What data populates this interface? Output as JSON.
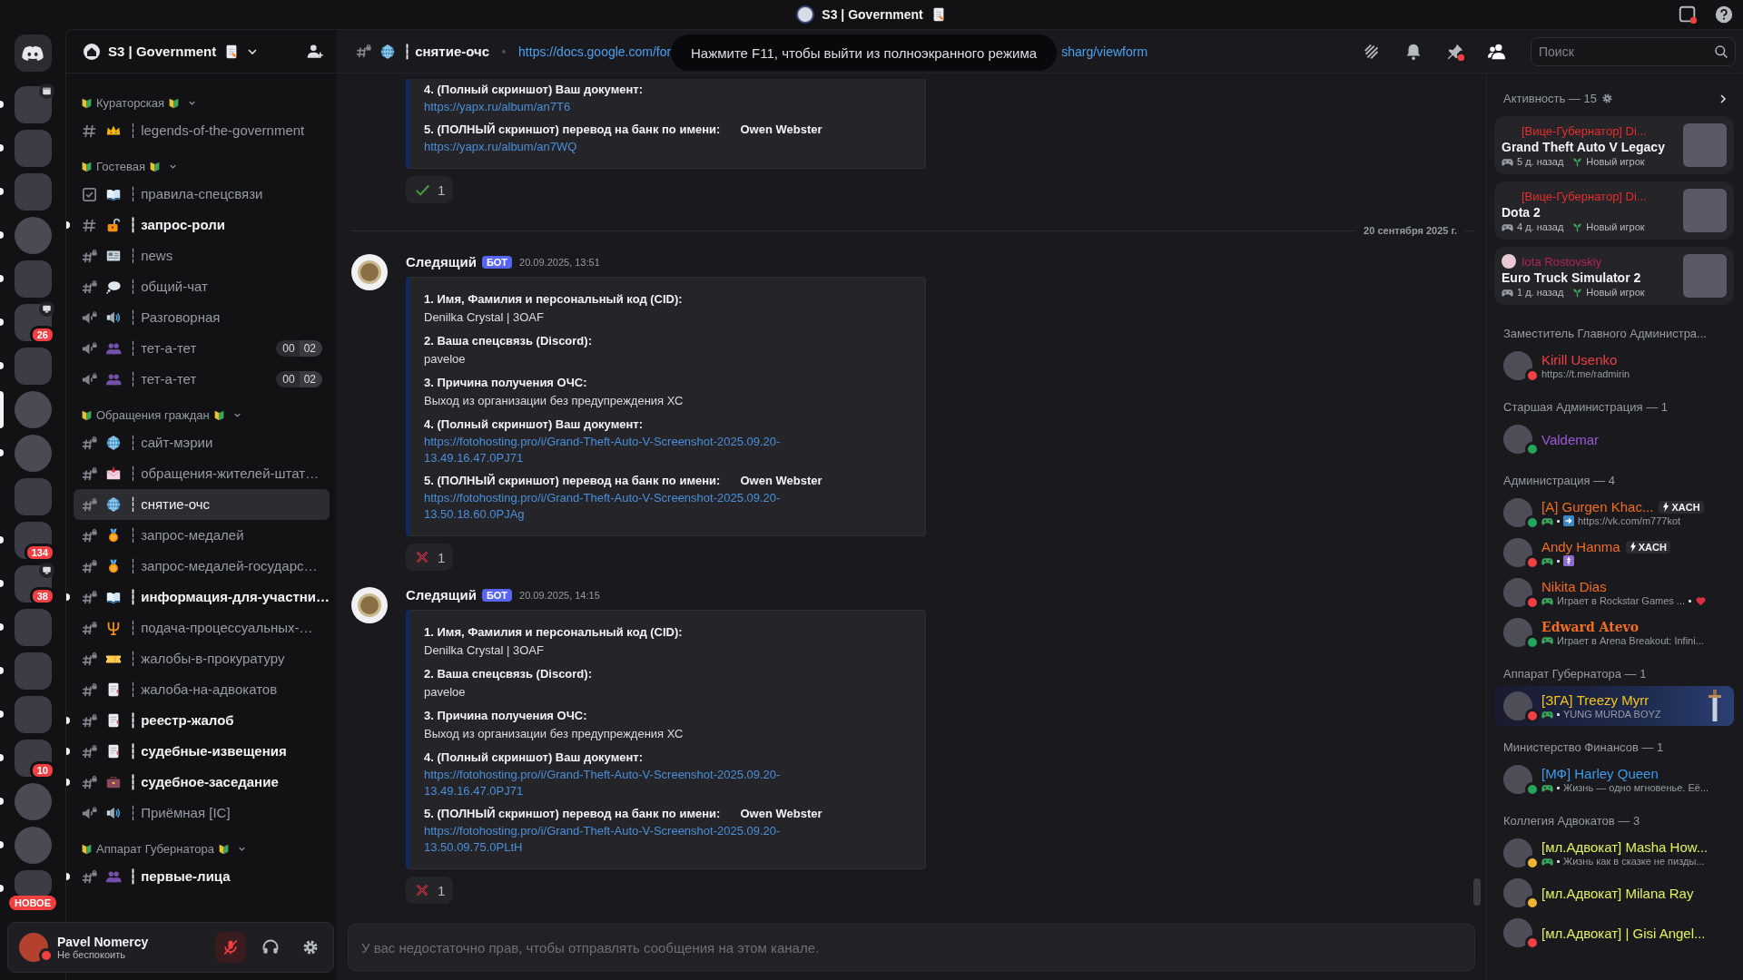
{
  "title_bar": {
    "server_name": "S3 | Government",
    "inbox_alert": true
  },
  "servers": [
    {
      "kind": "home",
      "unread": false,
      "selected": false
    },
    {
      "kind": "square",
      "event": true,
      "unread": true,
      "selected": false
    },
    {
      "kind": "square",
      "unread": true,
      "selected": false
    },
    {
      "kind": "square",
      "unread": true,
      "selected": false
    },
    {
      "kind": "round",
      "unread": true,
      "selected": false
    },
    {
      "kind": "square",
      "unread": true,
      "selected": false
    },
    {
      "kind": "square",
      "screen_share": true,
      "badge": "26",
      "unread": true,
      "selected": false
    },
    {
      "kind": "square",
      "unread": true,
      "selected": false
    },
    {
      "kind": "round",
      "unread": false,
      "selected": true
    },
    {
      "kind": "round",
      "unread": true,
      "selected": false
    },
    {
      "kind": "square",
      "unread": false,
      "selected": false
    },
    {
      "kind": "square",
      "badge": "134",
      "unread": true,
      "selected": false
    },
    {
      "kind": "square",
      "screen_share": true,
      "badge": "38",
      "unread": true,
      "selected": false
    },
    {
      "kind": "square",
      "unread": true,
      "selected": false
    },
    {
      "kind": "square",
      "unread": true,
      "selected": false
    },
    {
      "kind": "square",
      "unread": true,
      "selected": false
    },
    {
      "kind": "square",
      "badge": "10",
      "unread": true,
      "selected": false
    },
    {
      "kind": "round",
      "unread": true,
      "selected": false
    },
    {
      "kind": "round",
      "unread": true,
      "selected": false
    },
    {
      "kind": "square",
      "badge": "НОВОЕ",
      "unread": true,
      "selected": false
    }
  ],
  "sidebar": {
    "server_name": "S3 | Government",
    "categories": [
      {
        "name": "Кураторская",
        "channels": [
          {
            "kind": "text",
            "name": "┆ legends-of-the-government",
            "unread": false,
            "selected": false
          }
        ]
      },
      {
        "name": "Гостевая",
        "channels": [
          {
            "kind": "rules",
            "name": "┆ правила-спецсвязи",
            "unread": false,
            "selected": false
          },
          {
            "kind": "text",
            "name": "┆ запрос-роли",
            "unread": true,
            "selected": false
          },
          {
            "kind": "text_locked",
            "name": "┆ news",
            "unread": false,
            "selected": false
          },
          {
            "kind": "text_locked",
            "name": "┆ общий-чат",
            "unread": false,
            "selected": false
          },
          {
            "kind": "voice_locked",
            "name": "┆ Разговорная",
            "unread": false,
            "selected": false
          },
          {
            "kind": "voice_locked",
            "name": "┆ тет-а-тет",
            "unread": false,
            "selected": false,
            "counters": [
              "00",
              "02"
            ]
          },
          {
            "kind": "voice_locked",
            "name": "┆ тет-а-тет",
            "unread": false,
            "selected": false,
            "counters": [
              "00",
              "02"
            ]
          }
        ]
      },
      {
        "name": "Обращения граждан",
        "channels": [
          {
            "kind": "text_locked",
            "name": "┆ сайт-мэрии",
            "unread": false,
            "selected": false
          },
          {
            "kind": "text_locked",
            "name": "┆ обращения-жителей-штат…",
            "unread": false,
            "selected": false
          },
          {
            "kind": "text_locked",
            "name": "┆ снятие-очс",
            "unread": false,
            "selected": true
          },
          {
            "kind": "text_locked",
            "name": "┆ запрос-медалей",
            "unread": false,
            "selected": false
          },
          {
            "kind": "text_locked",
            "name": "┆ запрос-медалей-государс…",
            "unread": false,
            "selected": false
          },
          {
            "kind": "text_locked",
            "name": "┆ информация-для-участни…",
            "unread": true,
            "selected": false
          },
          {
            "kind": "text_locked",
            "name": "┆ подача-процессуальных-…",
            "unread": false,
            "selected": false
          },
          {
            "kind": "text_locked",
            "name": "┆ жалобы-в-прокуратуру",
            "unread": false,
            "selected": false
          },
          {
            "kind": "text_locked",
            "name": "┆ жалоба-на-адвокатов",
            "unread": false,
            "selected": false
          },
          {
            "kind": "text_locked",
            "name": "┆ реестр-жалоб",
            "unread": true,
            "selected": false
          },
          {
            "kind": "text_locked",
            "name": "┆ судебные-извещения",
            "unread": true,
            "selected": false
          },
          {
            "kind": "text_locked",
            "name": "┆ судебное-заседание",
            "unread": true,
            "selected": false
          },
          {
            "kind": "voice_locked",
            "name": "┆ Приёмная [IC]",
            "unread": false,
            "selected": false
          }
        ]
      },
      {
        "name": "Аппарат Губернатора",
        "channels": [
          {
            "kind": "text_locked",
            "name": "┆ первые-лица",
            "unread": true,
            "selected": false
          }
        ]
      }
    ]
  },
  "user_panel": {
    "name": "Pavel Nomercy",
    "status_text": "Не беспокоить",
    "status": {
      "color": "#f23f42"
    },
    "muted": true
  },
  "channel_header": {
    "kind": "text_locked",
    "name": "┆ снятие-очс",
    "topic_start": "https://docs.google.com/for",
    "topic_end": "sharg/viewform",
    "pins_alert": true,
    "members_shown": true,
    "search_placeholder": "Поиск"
  },
  "fullscreen_notice": "Нажмите F11, чтобы выйти из полноэкранного режима",
  "messages": [
    {
      "kind": "continuation",
      "fields": [
        {
          "label": "4. (Полный скриншот) Ваш документ:",
          "value": "https://yapx.ru/album/an7T6",
          "link": true
        },
        {
          "label": "5. (ПОЛНЫЙ скриншот) перевод на банк  по имени:",
          "extra": "Owen Webster",
          "value": "https://yapx.ru/album/an7WQ",
          "link": true
        }
      ],
      "reaction": {
        "kind": "check",
        "count": "1"
      }
    },
    {
      "kind": "divider",
      "text": "20 сентября 2025 г."
    },
    {
      "kind": "message",
      "author": "Следящий",
      "tag": "БОТ",
      "time": "20.09.2025, 13:51",
      "fields": [
        {
          "label": "1. Имя, Фамилия и персональный код (CID):",
          "value": "Denilka Crystal | 3OAF",
          "link": false
        },
        {
          "label": "2. Ваша спецсвязь (Discord):",
          "value": "paveloe",
          "link": false
        },
        {
          "label": "3. Причина получения ОЧС:",
          "value": "Выход из организации без предупреждения ХС",
          "link": false
        },
        {
          "label": "4. (Полный скриншот) Ваш документ:",
          "value": "https://fotohosting.pro/i/Grand-Theft-Auto-V-Screenshot-2025.09.20-13.49.16.47.0PJ71",
          "link": true
        },
        {
          "label": "5. (ПОЛНЫЙ скриншот) перевод на банк  по имени:",
          "extra": "Owen Webster",
          "value": "https://fotohosting.pro/i/Grand-Theft-Auto-V-Screenshot-2025.09.20-13.50.18.60.0PJAg",
          "link": true
        }
      ],
      "reaction": {
        "kind": "cross",
        "count": "1"
      }
    },
    {
      "kind": "message",
      "author": "Следящий",
      "tag": "БОТ",
      "time": "20.09.2025, 14:15",
      "fields": [
        {
          "label": "1. Имя, Фамилия и персональный код (CID):",
          "value": "Denilka Crystal | 3OAF",
          "link": false
        },
        {
          "label": "2. Ваша спецсвязь (Discord):",
          "value": "paveloe",
          "link": false
        },
        {
          "label": "3. Причина получения ОЧС:",
          "value": "Выход из организации без предупреждения ХС",
          "link": false
        },
        {
          "label": "4. (Полный скриншот) Ваш документ:",
          "value": "https://fotohosting.pro/i/Grand-Theft-Auto-V-Screenshot-2025.09.20-13.49.16.47.0PJ71",
          "link": true
        },
        {
          "label": "5. (ПОЛНЫЙ скриншот) перевод на банк  по имени:",
          "extra": "Owen Webster",
          "value": "https://fotohosting.pro/i/Grand-Theft-Auto-V-Screenshot-2025.09.20-13.50.09.75.0PLtH",
          "link": true
        }
      ],
      "reaction": {
        "kind": "cross",
        "count": "1"
      }
    }
  ],
  "composer": {
    "placeholder": "У вас недостаточно прав, чтобы отправлять сообщения на этом канале."
  },
  "activity": {
    "title": "Активность — 15",
    "cards": [
      {
        "user": "[Вице-Губернатор] Di...",
        "color": "#e5302b",
        "user_avatar": false,
        "game": "Grand Theft Auto V Legacy",
        "time": "5 д. назад",
        "note": "Новый игрок"
      },
      {
        "user": "[Вице-Губернатор] Di...",
        "color": "#e5302b",
        "user_avatar": false,
        "game": "Dota 2",
        "time": "4 д. назад",
        "note": "Новый игрок"
      },
      {
        "user": "Iota Rostovskiy",
        "color": "#b3245a",
        "user_avatar": true,
        "game": "Euro Truck Simulator 2",
        "time": "1 д. назад",
        "note": "Новый игрок"
      }
    ]
  },
  "member_groups": [
    {
      "title": "Заместитель Главного Администра...",
      "members": [
        {
          "name": "Kirill Usenko",
          "color": "#f23f42",
          "status": {
            "color": "#f23f42"
          },
          "activity": "https://t.me/radmirin",
          "kind": "text"
        }
      ]
    },
    {
      "title": "Старшая Администрация — 1",
      "members": [
        {
          "name": "Valdemar",
          "color": "#9b59d6",
          "status": {
            "color": "#23a55a"
          }
        }
      ]
    },
    {
      "title": "Администрация — 4",
      "members": [
        {
          "name": "[A] Gurgen Khac...",
          "color": "#f26c21",
          "status": {
            "color": "#23a55a"
          },
          "tag": "XACH",
          "activity": "https://vk.com/m777kot",
          "kind": "game_link"
        },
        {
          "name": "Andy Hanma",
          "color": "#f26c21",
          "status": {
            "color": "#f23f42"
          },
          "tag": "XACH",
          "kind": "game_cross"
        },
        {
          "name": "Nikita Dias",
          "color": "#f26c21",
          "status": {
            "color": "#f23f42"
          },
          "activity": "Играет в Rockstar Games ...",
          "kind": "game_heart"
        },
        {
          "name": "Edward Atevo",
          "color": "#f26c21",
          "fancy_name": true,
          "status": {
            "color": "#23a55a"
          },
          "activity": "Играет в Arena Breakout: Infini...",
          "kind": "game"
        }
      ]
    },
    {
      "title": "Аппарат Губернатора — 1",
      "members": [
        {
          "name": "[ЗГА] Treezy Myrr",
          "color": "#f5c518",
          "status": {
            "color": "#f23f42"
          },
          "activity": "YUNG MURDA BOYZ",
          "kind": "game_dot",
          "banner": true
        }
      ]
    },
    {
      "title": "Министерство Финансов — 1",
      "members": [
        {
          "name": "[МФ] Harley Queen",
          "color": "#3d9be9",
          "status": {
            "color": "#23a55a"
          },
          "activity": "Жизнь — одно мгновенье. Её...",
          "kind": "game_dot"
        }
      ]
    },
    {
      "title": "Коллегия Адвокатов — 3",
      "members": [
        {
          "name": "[мл.Адвокат] Masha How...",
          "color": "#e3f25a",
          "status": {
            "color": "#f0b232"
          },
          "activity": "Жизнь как в сказке не пизды...",
          "kind": "game_dot"
        },
        {
          "name": "[мл.Адвокат] Milana Ray",
          "color": "#e3f25a",
          "status": {
            "color": "#f0b232"
          }
        },
        {
          "name": "[мл.Адвокат] | Gisi Angel...",
          "color": "#e3f25a",
          "status": {
            "color": "#f23f42"
          }
        }
      ]
    }
  ]
}
